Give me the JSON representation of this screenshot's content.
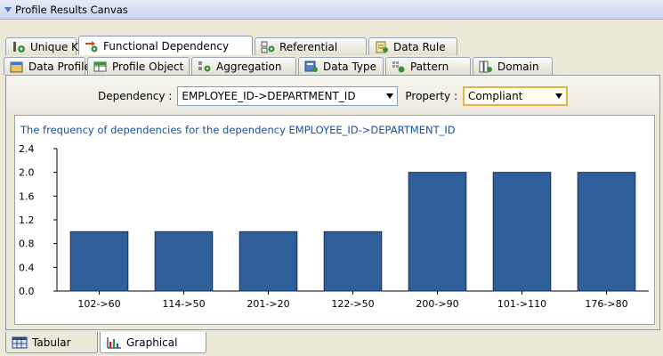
{
  "window": {
    "title": "Profile Results Canvas"
  },
  "tabs_row1": [
    {
      "label": "Unique Key",
      "icon": "unique-key-icon"
    },
    {
      "label": "Functional Dependency",
      "icon": "functional-dependency-icon",
      "active": true
    },
    {
      "label": "Referential",
      "icon": "referential-icon"
    },
    {
      "label": "Data Rule",
      "icon": "data-rule-icon"
    }
  ],
  "tabs_row2": [
    {
      "label": "Data Profile",
      "icon": "data-profile-icon"
    },
    {
      "label": "Profile Object",
      "icon": "profile-object-icon"
    },
    {
      "label": "Aggregation",
      "icon": "aggregation-icon"
    },
    {
      "label": "Data Type",
      "icon": "data-type-icon"
    },
    {
      "label": "Pattern",
      "icon": "pattern-icon"
    },
    {
      "label": "Domain",
      "icon": "domain-icon"
    }
  ],
  "filters": {
    "dependency_label": "Dependency :",
    "dependency_value": "EMPLOYEE_ID->DEPARTMENT_ID",
    "property_label": "Property :",
    "property_value": "Compliant"
  },
  "colors": {
    "bar": "#2f5f9a",
    "title_text": "#1a4fa0",
    "property_border": "#e6b24a"
  },
  "chart_data": {
    "type": "bar",
    "title": "The frequency of dependencies for the dependency EMPLOYEE_ID->DEPARTMENT_ID",
    "categories": [
      "102->60",
      "114->50",
      "201->20",
      "122->50",
      "200->90",
      "101->110",
      "176->80"
    ],
    "values": [
      1,
      1,
      1,
      1,
      2,
      2,
      2
    ],
    "yticks": [
      "0.0",
      "0.4",
      "0.8",
      "1.2",
      "1.6",
      "2.0",
      "2.4"
    ],
    "ylim": [
      0,
      2.4
    ],
    "xlabel": "",
    "ylabel": "",
    "grid": false
  },
  "bottom_tabs": [
    {
      "label": "Tabular",
      "icon": "tabular-icon"
    },
    {
      "label": "Graphical",
      "icon": "graphical-icon",
      "active": true
    }
  ]
}
